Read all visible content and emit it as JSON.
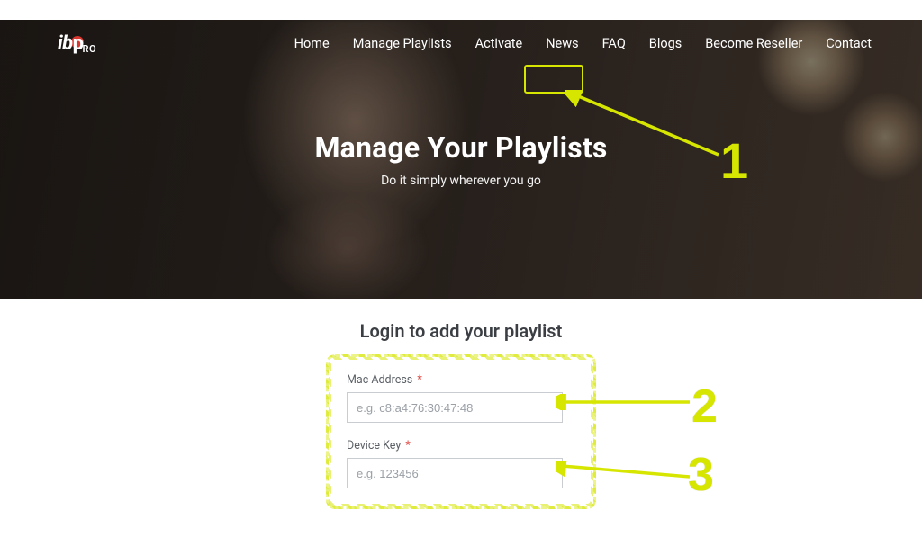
{
  "logo": {
    "ib": "ib",
    "p": "p",
    "ro": "RO"
  },
  "nav": {
    "home": "Home",
    "managePlaylists": "Manage Playlists",
    "activate": "Activate",
    "news": "News",
    "faq": "FAQ",
    "blogs": "Blogs",
    "becomeReseller": "Become Reseller",
    "contact": "Contact"
  },
  "hero": {
    "title": "Manage Your Playlists",
    "subtitle": "Do it simply wherever you go"
  },
  "login": {
    "title": "Login to add your playlist",
    "mac": {
      "label": "Mac Address",
      "required": "*",
      "placeholder": "e.g. c8:a4:76:30:47:48"
    },
    "key": {
      "label": "Device Key",
      "required": "*",
      "placeholder": "e.g. 123456"
    }
  },
  "annotations": {
    "n1": "1",
    "n2": "2",
    "n3": "3"
  },
  "colors": {
    "accent": "#d6e600",
    "brandRed": "#d9362f"
  }
}
